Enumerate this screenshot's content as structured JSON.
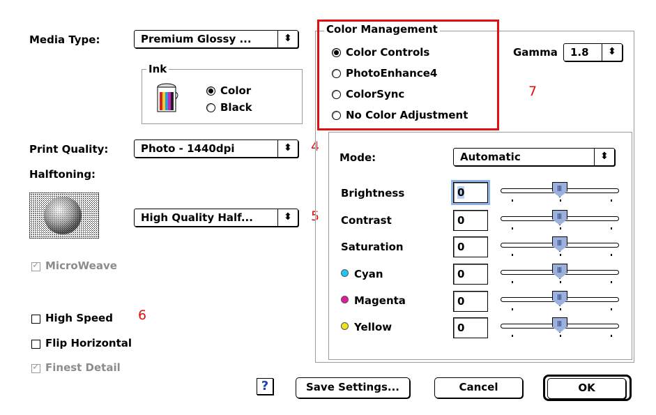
{
  "left": {
    "media_type_label": "Media Type:",
    "media_type_value": "Premium Glossy ...",
    "ink_title": "Ink",
    "ink_options": [
      {
        "label": "Color",
        "selected": true
      },
      {
        "label": "Black",
        "selected": false
      }
    ],
    "print_quality_label": "Print Quality:",
    "print_quality_value": "Photo - 1440dpi",
    "halftoning_label": "Halftoning:",
    "halftoning_value": "High Quality Half...",
    "microweave_label": "MicroWeave",
    "high_speed_label": "High Speed",
    "flip_horizontal_label": "Flip Horizontal",
    "finest_detail_label": "Finest Detail"
  },
  "color_management": {
    "title": "Color Management",
    "options": [
      {
        "label": "Color Controls",
        "selected": true
      },
      {
        "label": "PhotoEnhance4",
        "selected": false
      },
      {
        "label": "ColorSync",
        "selected": false
      },
      {
        "label": "No Color Adjustment",
        "selected": false
      }
    ],
    "gamma_label": "Gamma",
    "gamma_value": "1.8",
    "mode_label": "Mode:",
    "mode_value": "Automatic",
    "adjustments": [
      {
        "label": "Brightness",
        "value": "0",
        "dot": null
      },
      {
        "label": "Contrast",
        "value": "0",
        "dot": null
      },
      {
        "label": "Saturation",
        "value": "0",
        "dot": null
      },
      {
        "label": "Cyan",
        "value": "0",
        "dot": "#1ec8f0"
      },
      {
        "label": "Magenta",
        "value": "0",
        "dot": "#e01a9e"
      },
      {
        "label": "Yellow",
        "value": "0",
        "dot": "#f2e21c"
      }
    ]
  },
  "annotations": {
    "n4": "4",
    "n5": "5",
    "n6": "6",
    "n7": "7"
  },
  "buttons": {
    "help": "?",
    "save_settings": "Save Settings...",
    "cancel": "Cancel",
    "ok": "OK"
  },
  "colors": {
    "annotation_red": "#e01010",
    "slider_thumb": "#9bb0dd",
    "focus_ring": "#8fb4e8"
  },
  "icons": {
    "ink": "ink-cartridge-icon",
    "halftone": "halftone-preview-icon",
    "popup_arrow": "up-down-arrows-icon"
  }
}
